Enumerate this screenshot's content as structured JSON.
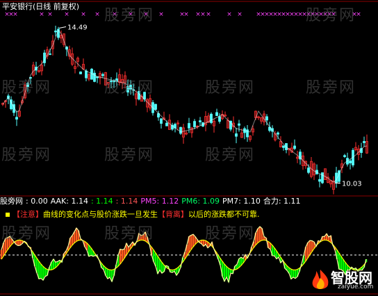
{
  "title": "平安银行(日线 前复权)",
  "high_label": "14.49",
  "low_label": "10.03",
  "watermark": "股旁网",
  "indicator": {
    "name": "股旁网",
    "v0": ": 0.00",
    "aak": "AAK: 1.14",
    "v1": ": 1.14",
    "v2": ": 1.14",
    "pm5": "PM5: 1.12",
    "pm6": "PM6: 1.09",
    "pm7": "PM7: 1.10",
    "heli": "合力: 1.11"
  },
  "note": {
    "left_bracket": "【注意】",
    "text1": "曲线的变化点与股价涨跌一旦发生",
    "right_bracket": "【背离】",
    "text2": "以后的涨跌都不可靠."
  },
  "logo": {
    "name": "智股网",
    "url": "zaiyue.com"
  },
  "colors": {
    "up": "#ff3030",
    "down": "#54ffff",
    "ma": "#ffffff",
    "grid": "#8b0000",
    "green": "#00ff00",
    "yellow": "#ffff00",
    "magenta": "#ff44ff",
    "orange": "#ff5a1e"
  },
  "chart_data": {
    "type": "candlestick",
    "title": "平安银行(日线 前复权)",
    "max_price": 14.49,
    "min_price": 10.03,
    "ylim": [
      9.8,
      14.8
    ]
  }
}
